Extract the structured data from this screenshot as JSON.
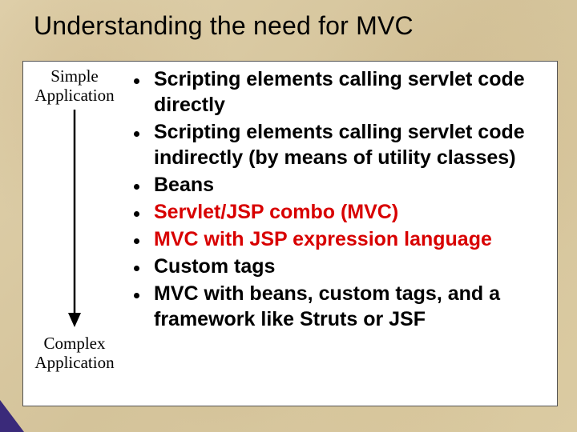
{
  "title": "Understanding the need for MVC",
  "left": {
    "top_label_line1": "Simple",
    "top_label_line2": "Application",
    "bottom_label_line1": "Complex",
    "bottom_label_line2": "Application"
  },
  "bullets": [
    {
      "text": "Scripting elements calling servlet code directly",
      "highlight": false
    },
    {
      "text": "Scripting elements calling servlet code indirectly (by means of utility classes)",
      "highlight": false
    },
    {
      "text": "Beans",
      "highlight": false
    },
    {
      "text": "Servlet/JSP combo (MVC)",
      "highlight": true
    },
    {
      "text": "MVC with JSP expression language",
      "highlight": true
    },
    {
      "text": "Custom tags",
      "highlight": false
    },
    {
      "text": "MVC with beans, custom tags, and a framework like Struts or JSF",
      "highlight": false
    }
  ]
}
